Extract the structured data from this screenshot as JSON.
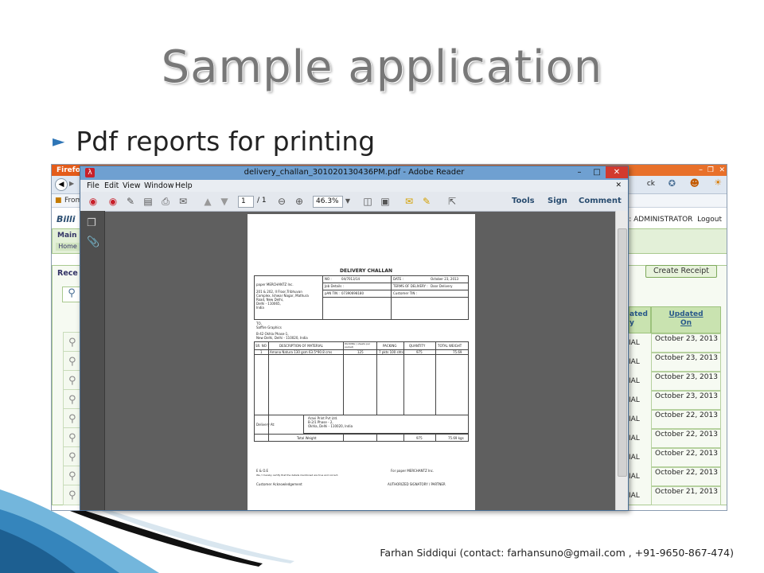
{
  "slide": {
    "title": "Sample application",
    "bullet": "Pdf reports for printing",
    "footer": "Farhan Siddiqui (contact: farhansuno@gmail.com , +91-9650-867-474)",
    "accent_color": "#2e75b6"
  },
  "browser": {
    "app_button": "Firefox",
    "bookmark_label": "From",
    "welcome": "Welcome: ADMINISTRATOR",
    "logout": "Logout",
    "main_panel_label": "Main",
    "home_link": "Home",
    "receipt_panel_label": "Rece",
    "create_receipt_button": "Create Receipt",
    "partial_column_header": "ated\ny",
    "updated_column_header": "Updated\nOn",
    "nav_back_label": "ck",
    "rows": [
      {
        "status": "IAL",
        "updated_on": "October 23, 2013"
      },
      {
        "status": "IAL",
        "updated_on": "October 23, 2013"
      },
      {
        "status": "IAL",
        "updated_on": "October 23, 2013"
      },
      {
        "status": "IAL",
        "updated_on": "October 23, 2013"
      },
      {
        "status": "IAL",
        "updated_on": "October 22, 2013"
      },
      {
        "status": "IAL",
        "updated_on": "October 22, 2013"
      },
      {
        "status": "IAL",
        "updated_on": "October 22, 2013"
      },
      {
        "status": "IAL",
        "updated_on": "October 22, 2013"
      },
      {
        "status": "IAL",
        "updated_on": "October 21, 2013"
      }
    ]
  },
  "reader": {
    "window_title": "delivery_challan_301020130436PM.pdf - Adobe Reader",
    "menu": [
      "File",
      "Edit",
      "View",
      "Window",
      "Help"
    ],
    "page_current": "1",
    "page_total": "/ 1",
    "zoom": "46.3%",
    "tools_label": "Tools",
    "sign_label": "Sign",
    "comment_label": "Comment"
  },
  "document": {
    "heading": "DELIVERY CHALLAN",
    "no_label": "NO :",
    "no_value": "04/7013/14",
    "date_label": "DATE :",
    "date_value": "October 23, 2013",
    "company_name": "paper MERCHANTZ Inc.",
    "company_address": [
      "201 & 202, II Floor,Tribhuvan",
      "Complex, Ishwar Nagar, Mathura",
      "Road, New Delhi,",
      "Delhi - 110065,",
      "India"
    ],
    "job_details": "Job Details :",
    "terms_label": "TERMS OF DELIVERY :",
    "terms_value": "Door Delivery",
    "pan_label": "pAN TIN :",
    "pan_value": "07390698180",
    "customer_tin": "Customer TIN :",
    "to_label": "TO,",
    "to_name": "Saffire Graphics",
    "to_address": [
      "B-42 Okhla Phase-1,",
      "New Delhi, Delhi - 110020, India"
    ],
    "table_headers": [
      "SR. NO",
      "DESCRIPTION OF MATERIAL",
      "PACKING ( sheets per packet)",
      "PACKING",
      "QUANTITY",
      "TOTAL WEIGHT"
    ],
    "table_row": [
      "1",
      "Amana Natura 130 gsm 63.5*90.8 cms",
      "125",
      "7 pkts 100 shts",
      "975",
      "75.69"
    ],
    "delivery_at": "Delivery At:",
    "delivery_address": [
      "Aravi Print Pvt Ltd.",
      "B-2/1 Phase - 2,",
      "Okhla, Delhi - 110020, India"
    ],
    "total_weight_label": "Total Weight",
    "total_quantity": "975",
    "total_weight_value": "75.69 kgs",
    "eoe": "E & O.E",
    "certify": "We / I hereby certify that the details mentioned are true and correct.",
    "for_company": "For paper MERCHANTZ Inc.",
    "customer_ack": "Customer Acknowledgement",
    "authorized": "AUTHORIZED SIGNATORY / PARTNER"
  }
}
